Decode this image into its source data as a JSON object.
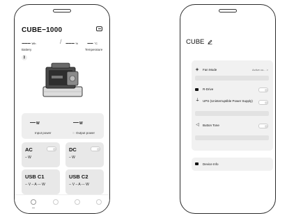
{
  "left": {
    "title": "CUBE−1000",
    "battery": {
      "value": "−−−",
      "unit": "Wh",
      "label": "Battery"
    },
    "separator": "/",
    "percent": {
      "value": "−−−",
      "unit": "%"
    },
    "temperature": {
      "value": "−−",
      "unit": "°C",
      "label": "Temperature"
    },
    "bt_symbol": "ᛒ",
    "input": {
      "value": "—",
      "unit": "W",
      "label": "Input power"
    },
    "output": {
      "value": "—",
      "unit": "W",
      "label": "Output power"
    },
    "tiles": [
      {
        "name": "AC",
        "value": "– W"
      },
      {
        "name": "DC",
        "value": "– W"
      },
      {
        "name": "USB C1",
        "value": "-- V – A --- W"
      },
      {
        "name": "USB C2",
        "value": "-- V – A --- W"
      }
    ]
  },
  "right": {
    "title": "CUBE",
    "fan_mode": {
      "label": "Fan Mode",
      "value": "Active co..."
    },
    "chevron": ">",
    "rdrive": {
      "label": "R-Drive"
    },
    "ups": {
      "label": "UPS (Uninterruptible Power Supply)"
    },
    "button_tone": {
      "label": "Button Tone"
    },
    "device_info": {
      "label": "Device Info"
    }
  },
  "colors": {
    "card": "#eeeeee",
    "tile": "#e8e8e8",
    "frame": "#2a2a2a"
  }
}
